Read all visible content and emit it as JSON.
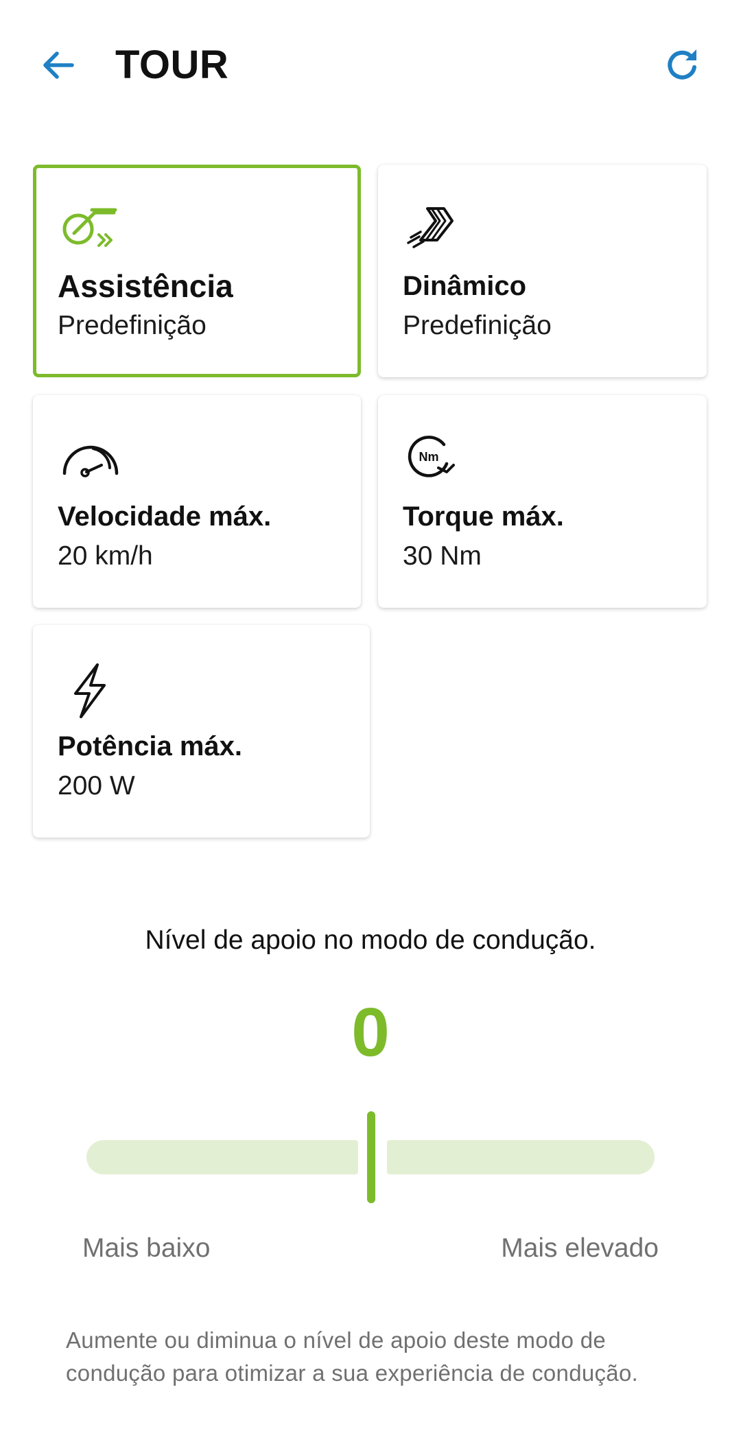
{
  "header": {
    "title": "TOUR",
    "back_icon": "arrow-left-icon",
    "refresh_icon": "refresh-icon",
    "accent_color": "#1f80c4"
  },
  "cards": [
    {
      "id": "assistencia",
      "icon": "assist-mode-icon",
      "label": "Assistência",
      "value": "Predefinição",
      "selected": true
    },
    {
      "id": "dinamico",
      "icon": "dynamic-icon",
      "label": "Dinâmico",
      "value": "Predefinição",
      "selected": false
    },
    {
      "id": "velocidade",
      "icon": "speedometer-icon",
      "label": "Velocidade máx.",
      "value": "20 km/h",
      "selected": false
    },
    {
      "id": "torque",
      "icon": "torque-icon",
      "label": "Torque máx.",
      "value": "30 Nm",
      "selected": false,
      "icon_text": "Nm"
    },
    {
      "id": "potencia",
      "icon": "lightning-icon",
      "label": "Potência máx.",
      "value": "200 W",
      "selected": false
    }
  ],
  "support": {
    "title": "Nível de apoio no modo de condução.",
    "level": "0",
    "slider_min_label": "Mais baixo",
    "slider_max_label": "Mais elevado",
    "help_text": "Aumente ou diminua o nível de apoio deste modo de condução para otimizar a sua experiência de condução.",
    "accent_color": "#7dbb2b",
    "track_color": "#e3efd3"
  }
}
